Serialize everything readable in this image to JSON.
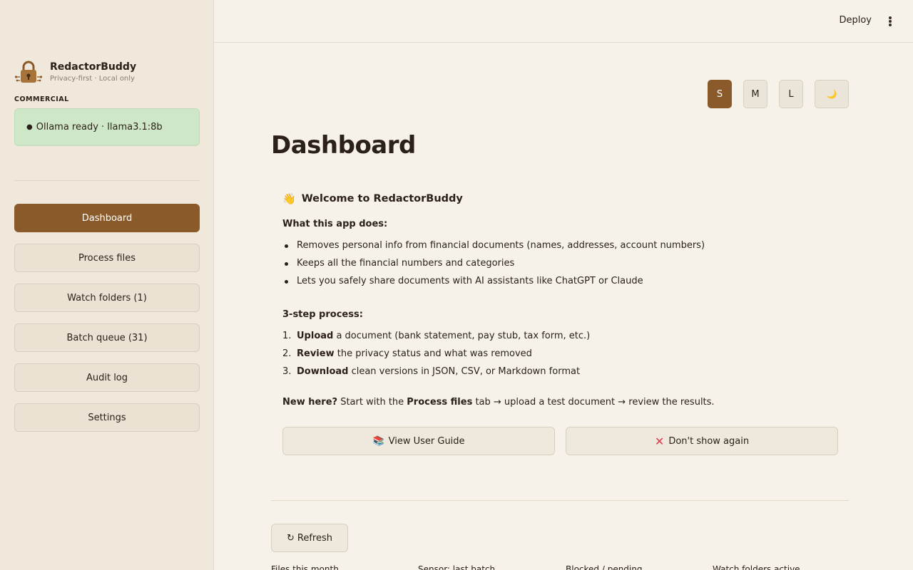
{
  "app": {
    "name": "RedactorBuddy",
    "tagline": "Privacy-first · Local only",
    "edition": "COMMERCIAL",
    "status": "Ollama ready · llama3.1:8b",
    "status_dot": "●",
    "logo_icon": "padlock-icon"
  },
  "nav": {
    "items": [
      {
        "label": "Dashboard",
        "active": true
      },
      {
        "label": "Process files"
      },
      {
        "label": "Watch folders (1)"
      },
      {
        "label": "Batch queue (31)"
      },
      {
        "label": "Audit log"
      },
      {
        "label": "Settings"
      }
    ]
  },
  "topbar": {
    "deploy_label": "Deploy"
  },
  "text_size": {
    "options": [
      "S",
      "M",
      "L"
    ],
    "selected": "S",
    "theme_toggle_icon": "🌙"
  },
  "page": {
    "title": "Dashboard"
  },
  "welcome": {
    "wave_icon": "👋",
    "title": "Welcome to RedactorBuddy",
    "what_heading": "What this app does:",
    "bullets": [
      "Removes personal info from financial documents (names, addresses, account numbers)",
      "Keeps all the financial numbers and categories",
      "Lets you safely share documents with AI assistants like ChatGPT or Claude"
    ],
    "steps_heading": "3-step process:",
    "steps": [
      {
        "num": "1.",
        "bold": "Upload",
        "rest": " a document (bank statement, pay stub, tax form, etc.)"
      },
      {
        "num": "2.",
        "bold": "Review",
        "rest": " the privacy status and what was removed"
      },
      {
        "num": "3.",
        "bold": "Download",
        "rest": " clean versions in JSON, CSV, or Markdown format"
      }
    ],
    "new_here": {
      "lead": "New here?",
      "part1": " Start with the ",
      "tab": "Process files",
      "part2": " tab → upload a test document → review the results."
    },
    "guide_icon": "📚",
    "guide_label": "View User Guide",
    "dismiss_icon": "✕",
    "dismiss_label": "Don't show again"
  },
  "actions": {
    "refresh_icon": "↻",
    "refresh_label": "Refresh"
  },
  "metrics": [
    "Files this month",
    "Sensor: last batch",
    "Blocked / pending",
    "Watch folders active"
  ],
  "colors": {
    "accent": "#8b5a2b",
    "status_ok_bg": "#cfe7c9",
    "background": "#f7f2e9",
    "sidebar_bg": "#f0e8da"
  }
}
